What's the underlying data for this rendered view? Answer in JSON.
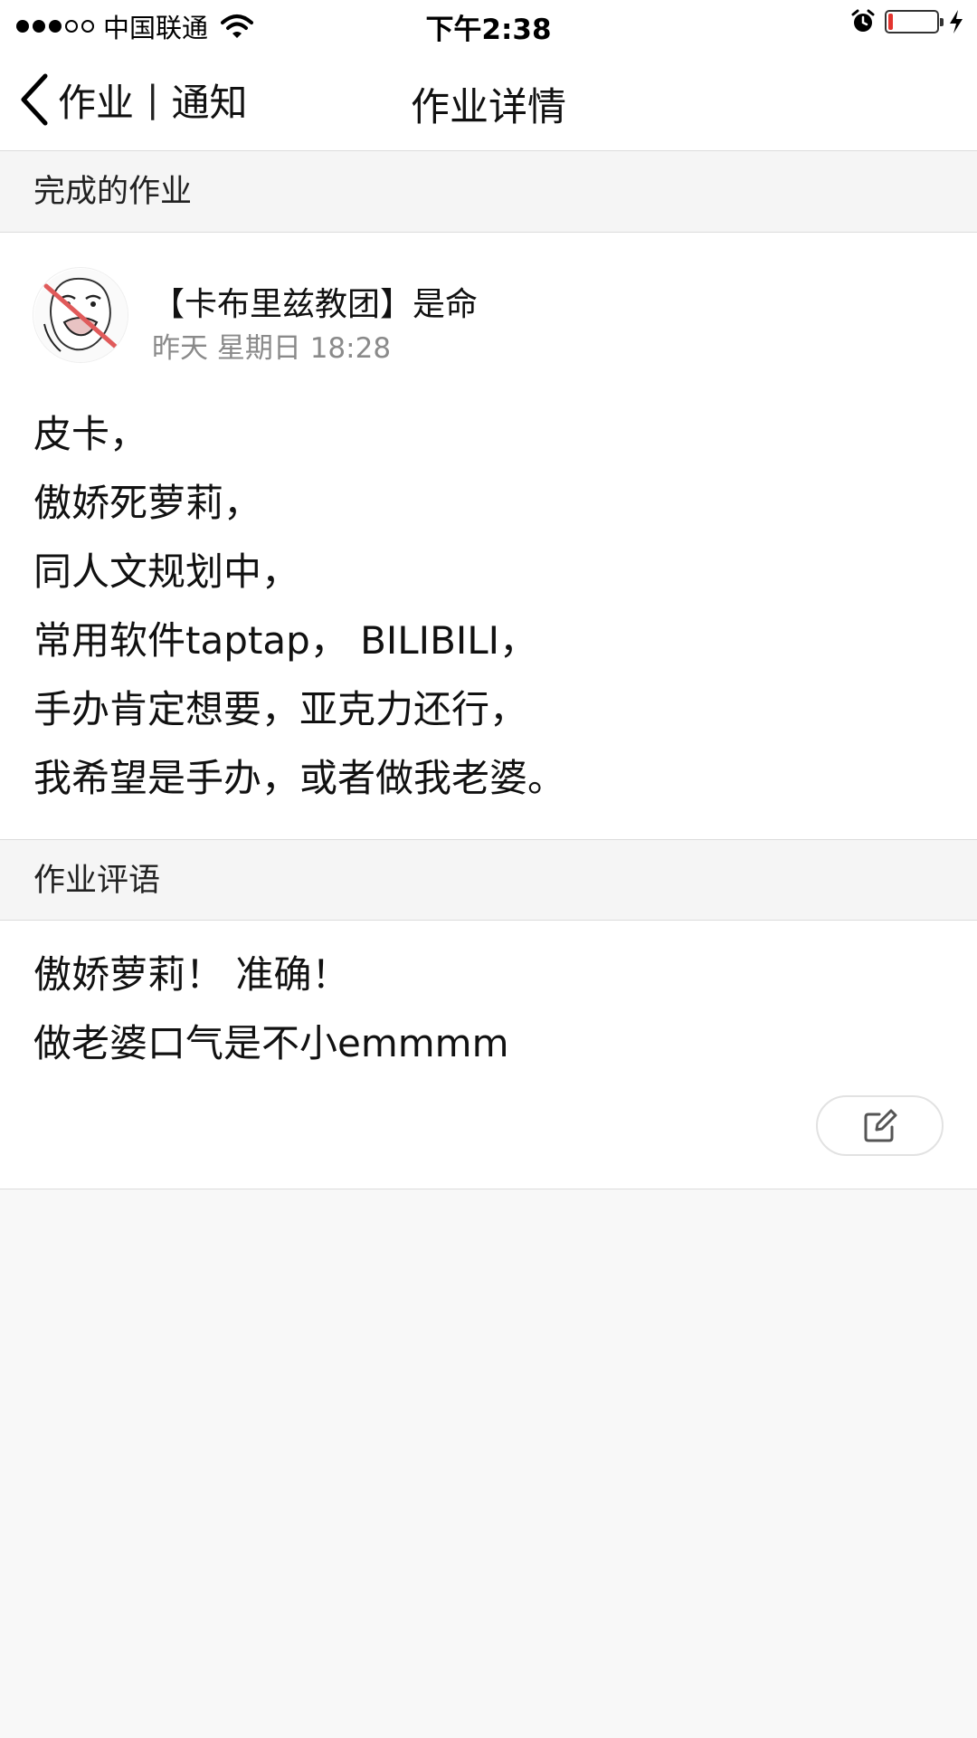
{
  "status_bar": {
    "carrier": "中国联通",
    "time": "下午2:38",
    "signal_strength": "3 of 5",
    "battery_level": 0.1,
    "charging": true
  },
  "nav": {
    "back_label": "作业",
    "separator": "|",
    "notice_label": "通知",
    "title": "作业详情"
  },
  "homework_section": {
    "header": "完成的作业",
    "author": "【卡布里兹教团】是命",
    "time": "昨天 星期日 18:28",
    "lines": [
      "皮卡，",
      "傲娇死萝莉，",
      "同人文规划中，",
      "常用软件taptap，  BILIBILI，",
      "手办肯定想要，亚克力还行，",
      "我希望是手办，或者做我老婆。"
    ]
  },
  "comment_section": {
    "header": "作业评语",
    "lines": [
      "傲娇萝莉！ 准确！",
      "做老婆口气是不小emmmm"
    ]
  },
  "icons": {
    "back": "chevron-left-icon",
    "edit": "edit-icon",
    "wifi": "wifi-icon",
    "alarm": "alarm-icon",
    "charging": "bolt-icon"
  },
  "colors": {
    "battery_low": "#e3342f",
    "secondary_text": "#8a8a8a",
    "page_bg": "#f8f8f8"
  }
}
